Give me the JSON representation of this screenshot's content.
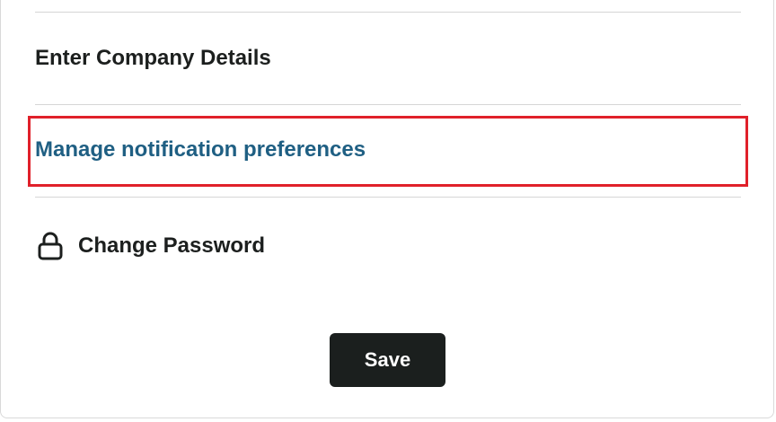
{
  "settings": {
    "items": [
      {
        "label": "Enter Company Details"
      },
      {
        "label": "Manage notification preferences"
      },
      {
        "label": "Change Password"
      }
    ],
    "save_label": "Save"
  },
  "colors": {
    "link": "#1f5f83",
    "highlight": "#e0202a",
    "button_bg": "#1b1f1e",
    "text": "#1c1f1e"
  },
  "icons": {
    "change_password": "lock-icon"
  }
}
